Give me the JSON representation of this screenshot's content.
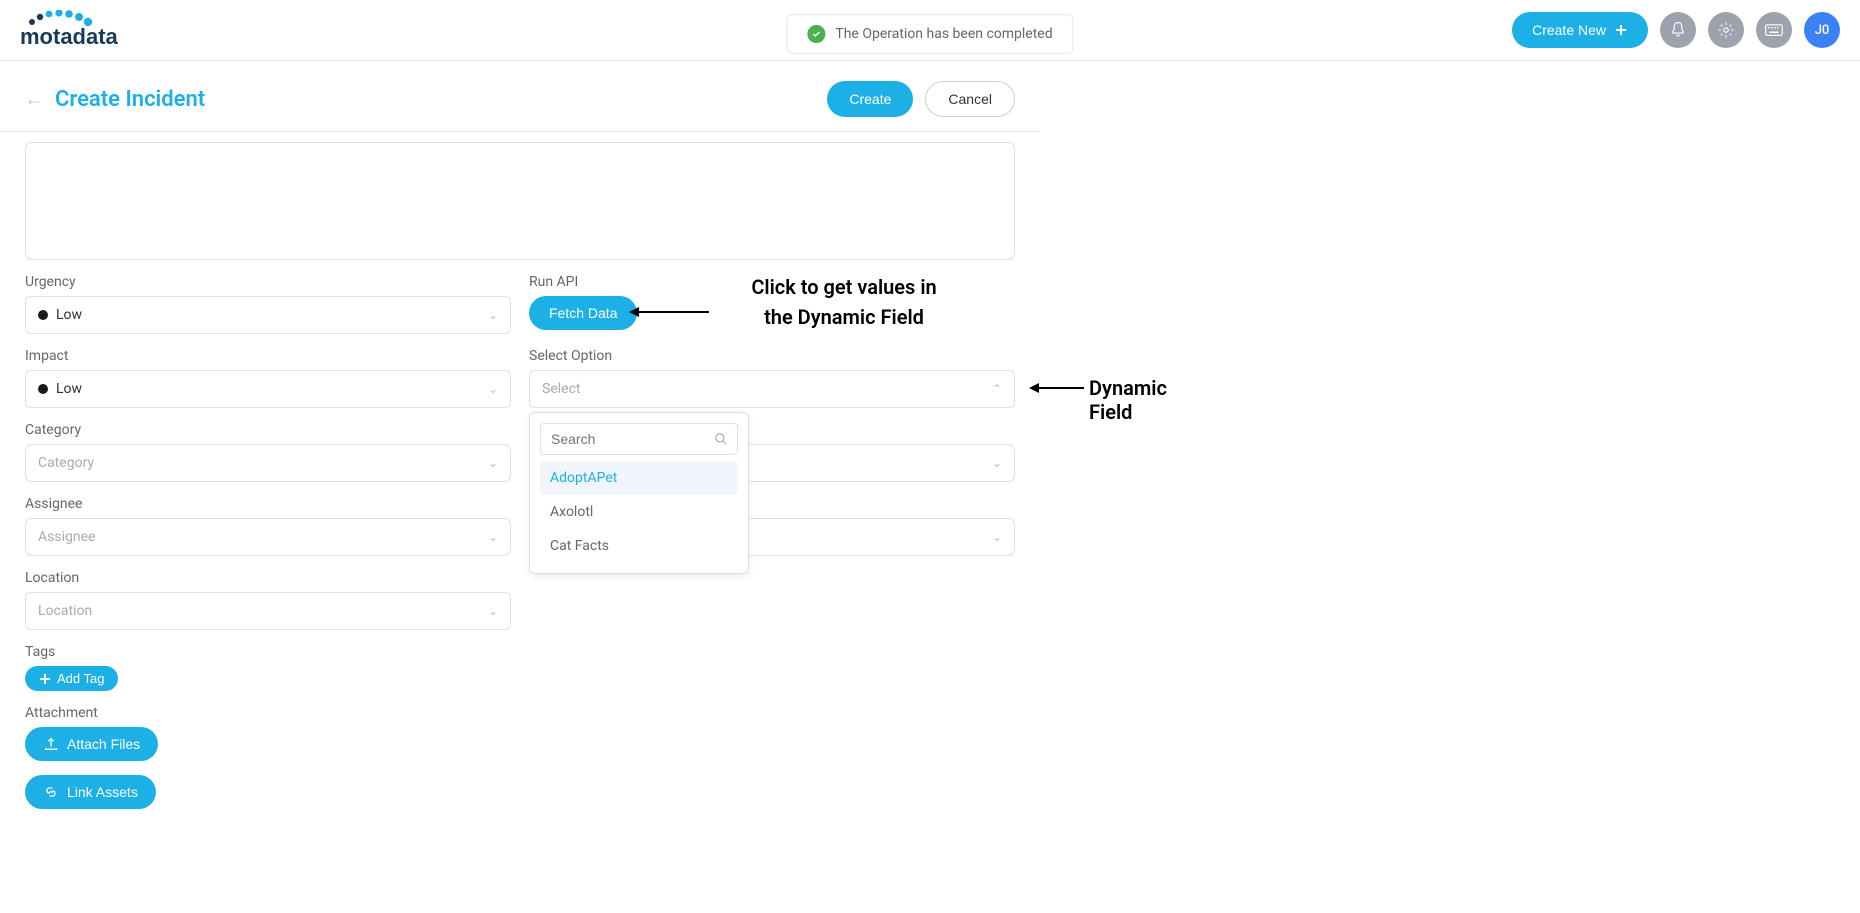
{
  "header": {
    "logo_text": "motadata",
    "toast_message": "The Operation has been completed",
    "create_new_label": "Create New",
    "avatar_text": "J0"
  },
  "page": {
    "title": "Create Incident",
    "create_label": "Create",
    "cancel_label": "Cancel"
  },
  "form": {
    "urgency": {
      "label": "Urgency",
      "value": "Low"
    },
    "impact": {
      "label": "Impact",
      "value": "Low"
    },
    "category": {
      "label": "Category",
      "placeholder": "Category"
    },
    "assignee": {
      "label": "Assignee",
      "placeholder": "Assignee"
    },
    "location": {
      "label": "Location",
      "placeholder": "Location"
    },
    "run_api": {
      "label": "Run API",
      "button_label": "Fetch Data"
    },
    "select_option": {
      "label": "Select Option",
      "placeholder": "Select",
      "search_placeholder": "Search",
      "options": [
        "AdoptAPet",
        "Axolotl",
        "Cat Facts"
      ]
    },
    "tags": {
      "label": "Tags",
      "button_label": "Add Tag"
    },
    "attachment": {
      "label": "Attachment",
      "button_label": "Attach Files"
    },
    "link_assets": {
      "button_label": "Link Assets"
    }
  },
  "annotations": {
    "fetch_line1": "Click to get values in",
    "fetch_line2": "the Dynamic Field",
    "dynamic_field": "Dynamic Field"
  }
}
